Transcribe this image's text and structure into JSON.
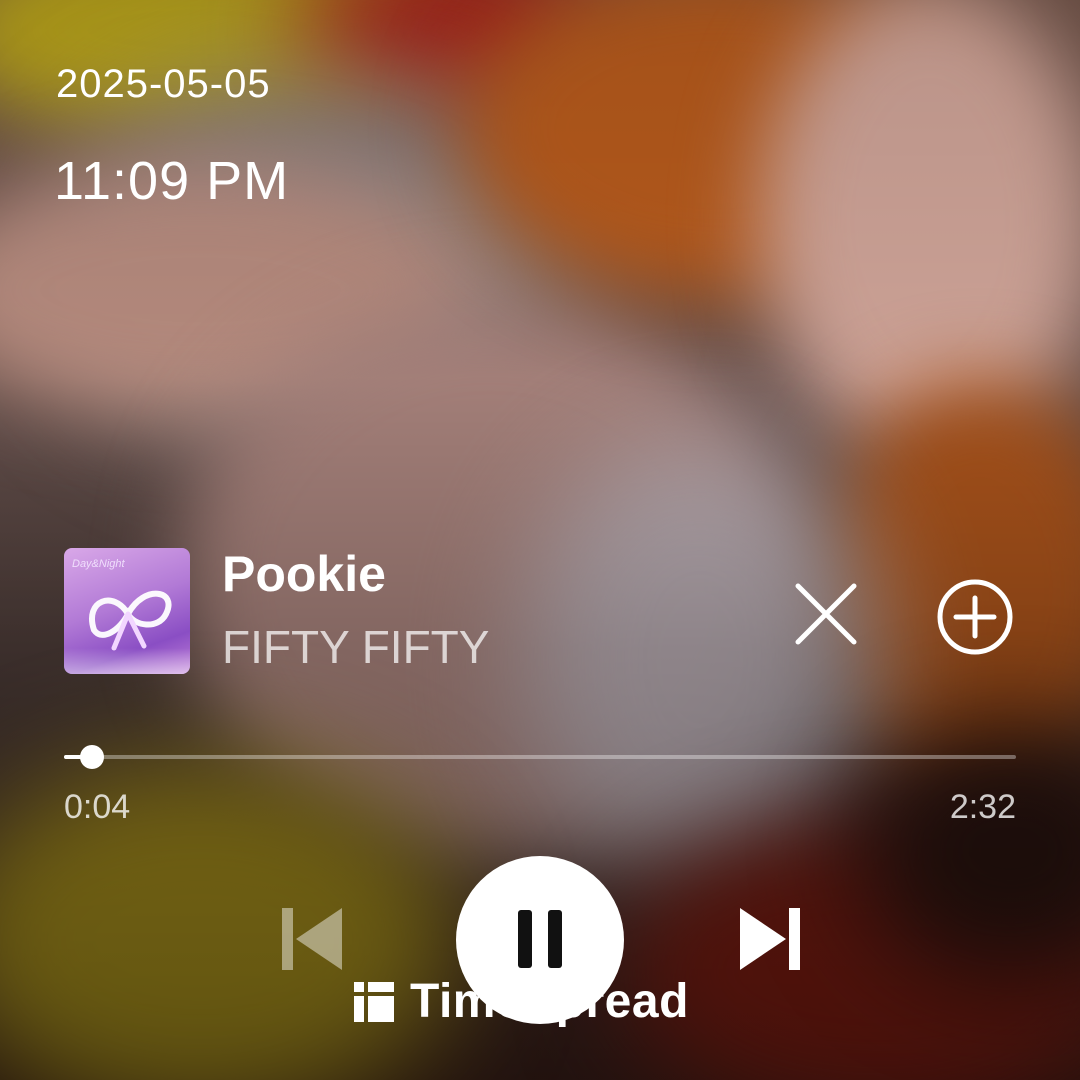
{
  "clock": {
    "date": "2025-05-05",
    "time": "11:09 PM"
  },
  "track": {
    "title": "Pookie",
    "artist": "FIFTY FIFTY",
    "album_art_text": "Day&Night",
    "album_art_colors": [
      "#d9a8e8",
      "#8a4ec4"
    ]
  },
  "progress": {
    "current": "0:04",
    "total": "2:32",
    "fraction": 0.029
  },
  "controls": {
    "prev_icon": "skip-previous-icon",
    "play_state": "playing",
    "pause_icon": "pause-icon",
    "next_icon": "skip-next-icon",
    "close_icon": "close-icon",
    "add_icon": "add-circle-icon"
  },
  "branding": {
    "name": "TimeSpread",
    "icon": "timespread-logo-icon"
  },
  "colors": {
    "text": "#ffffff",
    "accent": "#ffffff",
    "button_icon": "#111111"
  }
}
